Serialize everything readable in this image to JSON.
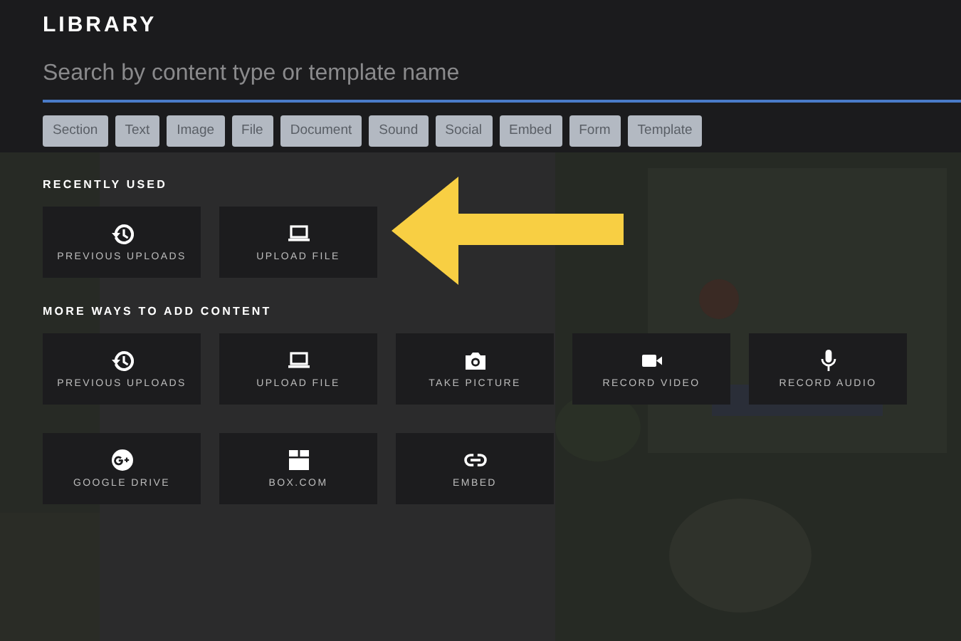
{
  "title": "LIBRARY",
  "search": {
    "placeholder": "Search by content type or template name"
  },
  "filters": [
    "Section",
    "Text",
    "Image",
    "File",
    "Document",
    "Sound",
    "Social",
    "Embed",
    "Form",
    "Template"
  ],
  "sections": [
    {
      "heading": "RECENTLY USED",
      "tiles": [
        {
          "label": "PREVIOUS UPLOADS",
          "kind": "history"
        },
        {
          "label": "UPLOAD FILE",
          "kind": "laptop"
        }
      ]
    },
    {
      "heading": "MORE WAYS TO ADD CONTENT",
      "tiles": [
        {
          "label": "PREVIOUS UPLOADS",
          "kind": "history"
        },
        {
          "label": "UPLOAD FILE",
          "kind": "laptop"
        },
        {
          "label": "TAKE PICTURE",
          "kind": "camera"
        },
        {
          "label": "RECORD VIDEO",
          "kind": "video"
        },
        {
          "label": "RECORD AUDIO",
          "kind": "mic"
        },
        {
          "label": "GOOGLE DRIVE",
          "kind": "gplus"
        },
        {
          "label": "BOX.COM",
          "kind": "box"
        },
        {
          "label": "EMBED",
          "kind": "link"
        }
      ]
    }
  ]
}
